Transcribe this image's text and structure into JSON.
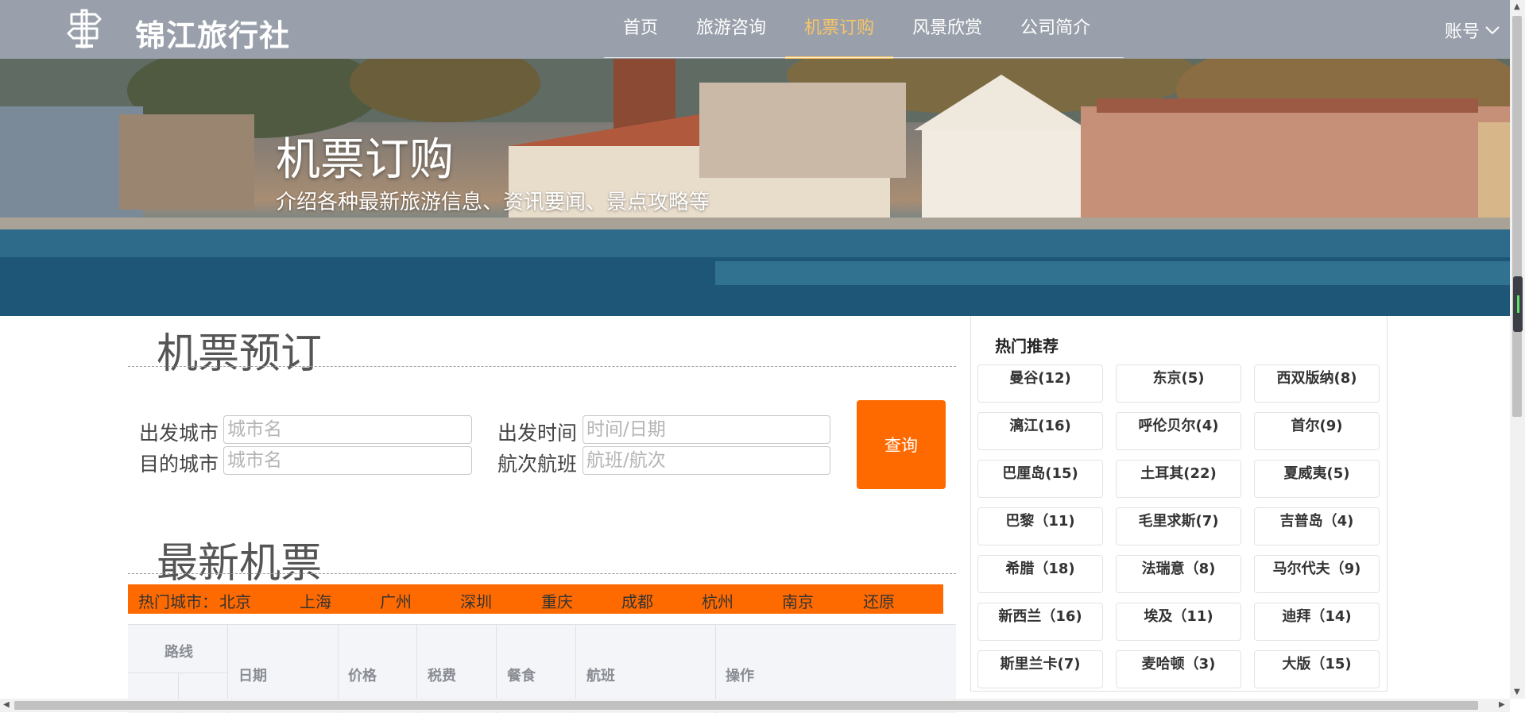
{
  "header": {
    "brand": "锦江旅行社",
    "nav": [
      {
        "label": "首页",
        "active": false
      },
      {
        "label": "旅游咨询",
        "active": false
      },
      {
        "label": "机票订购",
        "active": true
      },
      {
        "label": "风景欣赏",
        "active": false
      },
      {
        "label": "公司简介",
        "active": false
      }
    ],
    "account": "账号"
  },
  "banner": {
    "title": "机票订购",
    "subtitle": "介绍各种最新旅游信息、资讯要闻、景点攻略等"
  },
  "booking": {
    "title": "机票预订",
    "depart_city_label": "出发城市",
    "depart_city_placeholder": "城市名",
    "dest_city_label": "目的城市",
    "dest_city_placeholder": "城市名",
    "depart_time_label": "出发时间",
    "depart_time_placeholder": "时间/日期",
    "flight_label": "航次航班",
    "flight_placeholder": "航班/航次",
    "query_button": "查询"
  },
  "latest": {
    "title": "最新机票",
    "hot_city_label": "热门城市：",
    "hot_cities": [
      "北京",
      "上海",
      "广州",
      "深圳",
      "重庆",
      "成都",
      "杭州",
      "南京",
      "还原"
    ],
    "table_headers": {
      "route": "路线",
      "date": "日期",
      "price": "价格",
      "tax": "税费",
      "meal": "餐食",
      "flight": "航班",
      "action": "操作"
    }
  },
  "sidebar": {
    "title": "热门推荐",
    "items": [
      "曼谷(12)",
      "东京(5)",
      "西双版纳(8)",
      "漓江(16)",
      "呼伦贝尔(4)",
      "首尔(9)",
      "巴厘岛(15)",
      "土耳其(22)",
      "夏威夷(5)",
      "巴黎（11)",
      "毛里求斯(7)",
      "吉普岛（4)",
      "希腊（18)",
      "法瑞意（8)",
      "马尔代夫（9)",
      "新西兰（16)",
      "埃及（11)",
      "迪拜（14)",
      "斯里兰卡(7)",
      "麦哈顿（3)",
      "大版（15)"
    ]
  },
  "colors": {
    "header_bg": "#9aa0ab",
    "nav_active": "#f7c567",
    "accent_orange": "#ff6a00"
  }
}
